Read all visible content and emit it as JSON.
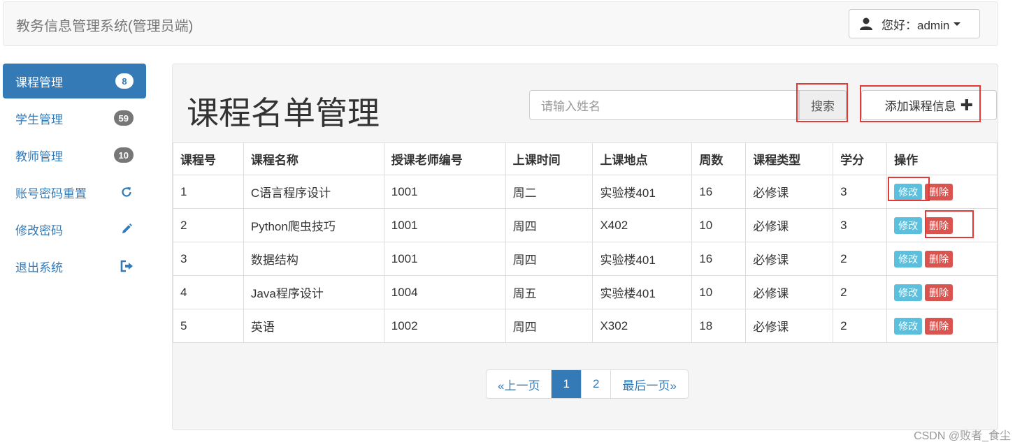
{
  "navbar": {
    "brand": "教务信息管理系统(管理员端)",
    "user_label": "您好：admin",
    "user_icon": "user-icon"
  },
  "sidebar": {
    "items": [
      {
        "label": "课程管理",
        "badge": "8",
        "active": true
      },
      {
        "label": "学生管理",
        "badge": "59"
      },
      {
        "label": "教师管理",
        "badge": "10"
      },
      {
        "label": "账号密码重置",
        "icon": "refresh-icon"
      },
      {
        "label": "修改密码",
        "icon": "pencil-icon"
      },
      {
        "label": "退出系统",
        "icon": "logout-icon"
      }
    ]
  },
  "main": {
    "title": "课程名单管理",
    "search_placeholder": "请输入姓名",
    "search_button": "搜索",
    "add_button": "添加课程信息",
    "table": {
      "headers": [
        "课程号",
        "课程名称",
        "授课老师编号",
        "上课时间",
        "上课地点",
        "周数",
        "课程类型",
        "学分",
        "操作"
      ],
      "rows": [
        [
          "1",
          "C语言程序设计",
          "1001",
          "周二",
          "实验楼401",
          "16",
          "必修课",
          "3"
        ],
        [
          "2",
          "Python爬虫技巧",
          "1001",
          "周四",
          "X402",
          "10",
          "必修课",
          "3"
        ],
        [
          "3",
          "数据结构",
          "1001",
          "周四",
          "实验楼401",
          "16",
          "必修课",
          "2"
        ],
        [
          "4",
          "Java程序设计",
          "1004",
          "周五",
          "实验楼401",
          "10",
          "必修课",
          "2"
        ],
        [
          "5",
          "英语",
          "1002",
          "周四",
          "X302",
          "18",
          "必修课",
          "2"
        ]
      ],
      "edit_label": "修改",
      "delete_label": "删除"
    },
    "pagination": {
      "prev": "«上一页",
      "pages": [
        "1",
        "2"
      ],
      "current": "1",
      "last": "最后一页»"
    }
  },
  "watermark": "CSDN @败者_食尘",
  "colors": {
    "primary": "#337ab7",
    "info": "#5bc0de",
    "danger": "#d9534f",
    "highlight": "#e53935"
  }
}
